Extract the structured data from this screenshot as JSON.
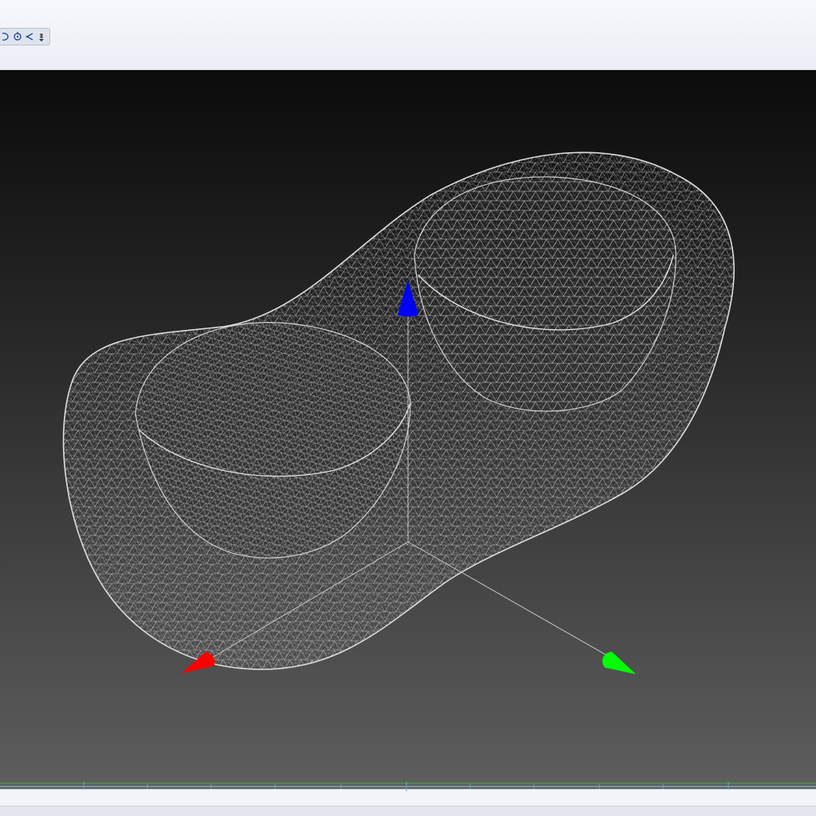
{
  "window": {
    "toolbar": {
      "buttons": [
        {
          "icon": "pan-icon"
        },
        {
          "icon": "rotate-icon"
        },
        {
          "icon": "light-icon"
        },
        {
          "icon": "dropdown-icon"
        }
      ]
    }
  },
  "viewport": {
    "background_top": "#0b0b0b",
    "background_bottom": "#5e5e5e",
    "mesh_color": "#cfcfcf",
    "axes": {
      "x_color": "#ff0000",
      "y_color": "#00ff00",
      "z_color": "#0000ff"
    }
  },
  "timeline": {
    "track_color": "#7fd0e6",
    "ground_color": "#4aa84a"
  }
}
